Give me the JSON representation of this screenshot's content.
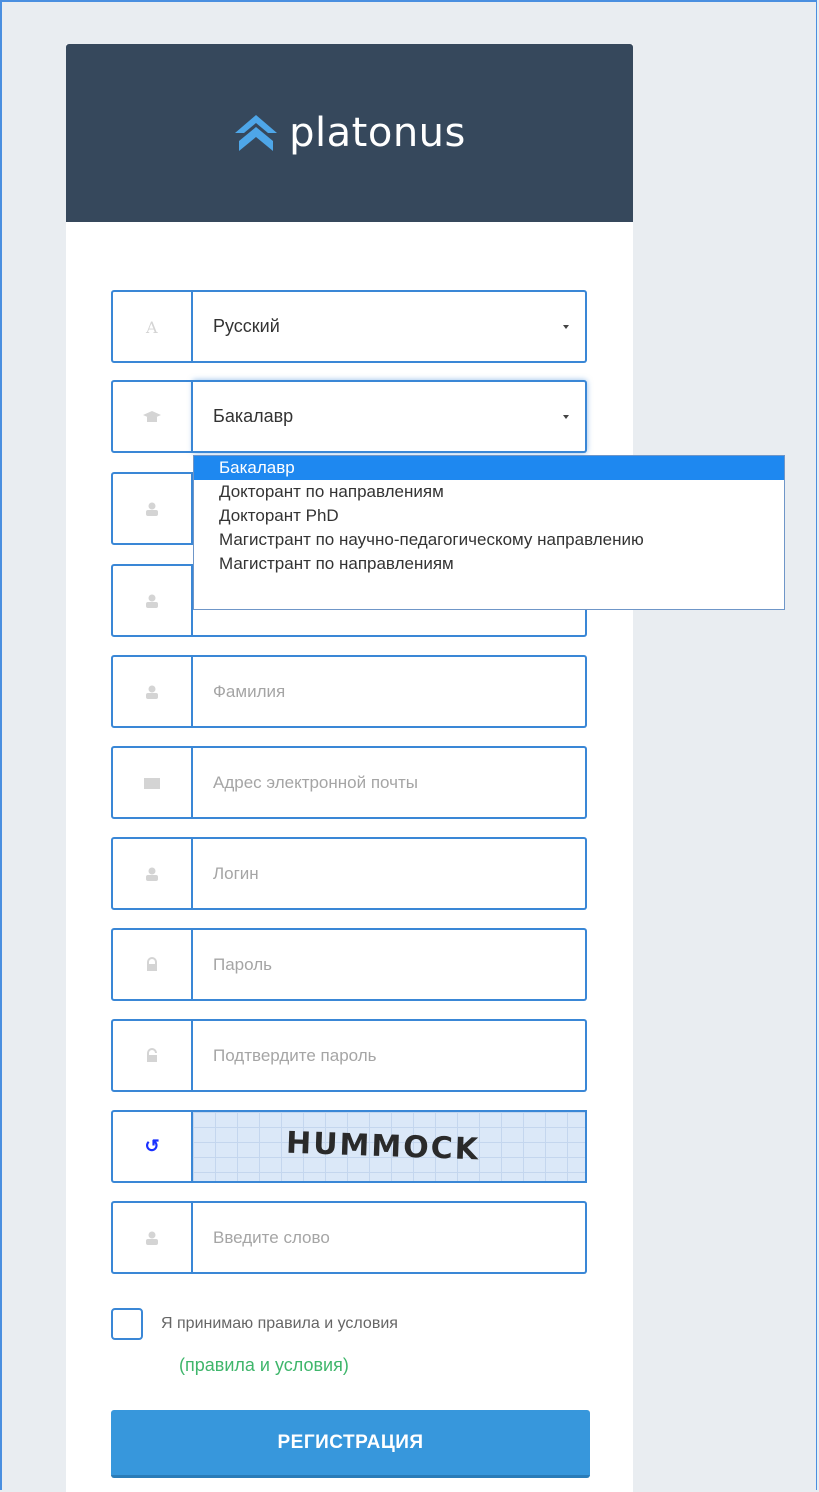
{
  "brand": {
    "name": "platonus",
    "logo_color": "#4ea6e8"
  },
  "colors": {
    "header_bg": "#36485c",
    "border": "#3a87d6",
    "accent": "#3797dc",
    "link": "#3fb66b"
  },
  "language_select": {
    "value": "Русский",
    "icon": "font-icon"
  },
  "degree_select": {
    "value": "Бакалавр",
    "icon": "graduation-cap-icon",
    "options": [
      "Бакалавр",
      "Докторант по направлениям",
      "Докторант PhD",
      "Магистрант по научно-педагогическому направлению",
      "Магистрант по направлениям"
    ]
  },
  "fields": {
    "lastname_placeholder": "Фамилия",
    "email_placeholder": "Адрес электронной почты",
    "login_placeholder": "Логин",
    "password_placeholder": "Пароль",
    "confirm_password_placeholder": "Подтвердите пароль",
    "captcha_input_placeholder": "Введите слово"
  },
  "captcha": {
    "word": "HUMMOCK",
    "refresh_icon": "refresh-icon"
  },
  "terms": {
    "label": "Я принимаю правила и условия",
    "link": "(правила и условия)"
  },
  "register_button": "РЕГИСТРАЦИЯ"
}
